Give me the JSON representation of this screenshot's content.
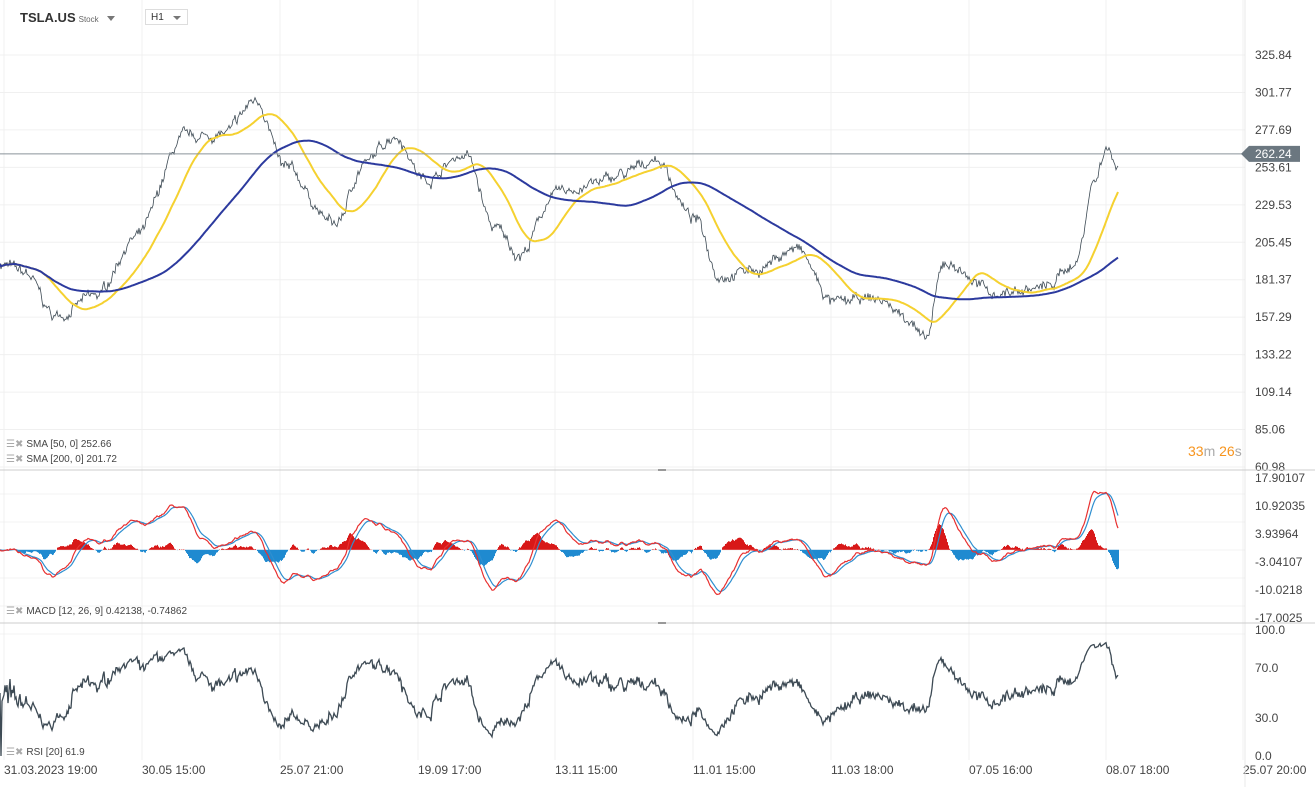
{
  "header": {
    "symbol": "TSLA.US",
    "type": "Stock",
    "timeframe": "H1"
  },
  "legend": {
    "sma50": "SMA [50, 0] 252.66",
    "sma200": "SMA [200, 0] 201.72",
    "macd": "MACD [12, 26, 9] 0.42138, -0.74862",
    "rsi": "RSI [20] 61.9"
  },
  "timer": {
    "m": "33",
    "m_unit": "m",
    "s": "26",
    "s_unit": "s"
  },
  "colors": {
    "price": "#3d4a54",
    "sma50": "#f5d130",
    "sma200": "#2c3a9e",
    "macd": "#e83030",
    "signal": "#2f8fd0",
    "hist_pos": "#d81818",
    "hist_neg": "#1f8ad0",
    "rsi": "#3d4a54"
  },
  "chart_data": {
    "type": "line",
    "title": "TSLA.US H1",
    "current_price": "262.24",
    "price_axis": {
      "ticks": [
        "325.84",
        "301.77",
        "277.69",
        "253.61",
        "229.53",
        "205.45",
        "181.37",
        "157.29",
        "133.22",
        "109.14",
        "85.06",
        "60.98"
      ],
      "ylim": [
        60.98,
        325.84
      ]
    },
    "macd_axis": {
      "ticks": [
        "17.90107",
        "10.92035",
        "3.93964",
        "-3.04107",
        "-10.0218",
        "-17.0025"
      ],
      "ylim": [
        -17.0025,
        17.90107
      ]
    },
    "rsi_axis": {
      "ticks": [
        "100.0",
        "70.0",
        "30.0",
        "0.0"
      ],
      "ylim": [
        0,
        100
      ]
    },
    "x_ticks": [
      "31.03.2023  19:00",
      "30.05  15:00",
      "25.07  21:00",
      "19.09  17:00",
      "13.11  15:00",
      "11.01  15:00",
      "11.03  18:00",
      "07.05  16:00",
      "08.07  18:00",
      "25.07  20:00"
    ],
    "price_waypoints": [
      [
        0,
        192
      ],
      [
        25,
        185
      ],
      [
        55,
        158
      ],
      [
        95,
        170
      ],
      [
        135,
        208
      ],
      [
        185,
        272
      ],
      [
        225,
        275
      ],
      [
        257,
        297
      ],
      [
        285,
        252
      ],
      [
        335,
        217
      ],
      [
        365,
        256
      ],
      [
        395,
        275
      ],
      [
        425,
        246
      ],
      [
        465,
        262
      ],
      [
        495,
        214
      ],
      [
        520,
        198
      ],
      [
        555,
        236
      ],
      [
        595,
        243
      ],
      [
        625,
        249
      ],
      [
        655,
        259
      ],
      [
        695,
        220
      ],
      [
        720,
        185
      ],
      [
        755,
        188
      ],
      [
        795,
        201
      ],
      [
        835,
        166
      ],
      [
        875,
        169
      ],
      [
        910,
        157
      ],
      [
        925,
        141
      ],
      [
        945,
        192
      ],
      [
        995,
        173
      ],
      [
        1045,
        176
      ],
      [
        1075,
        192
      ],
      [
        1095,
        246
      ],
      [
        1107,
        268
      ],
      [
        1115,
        256
      ],
      [
        1118,
        257
      ]
    ]
  }
}
